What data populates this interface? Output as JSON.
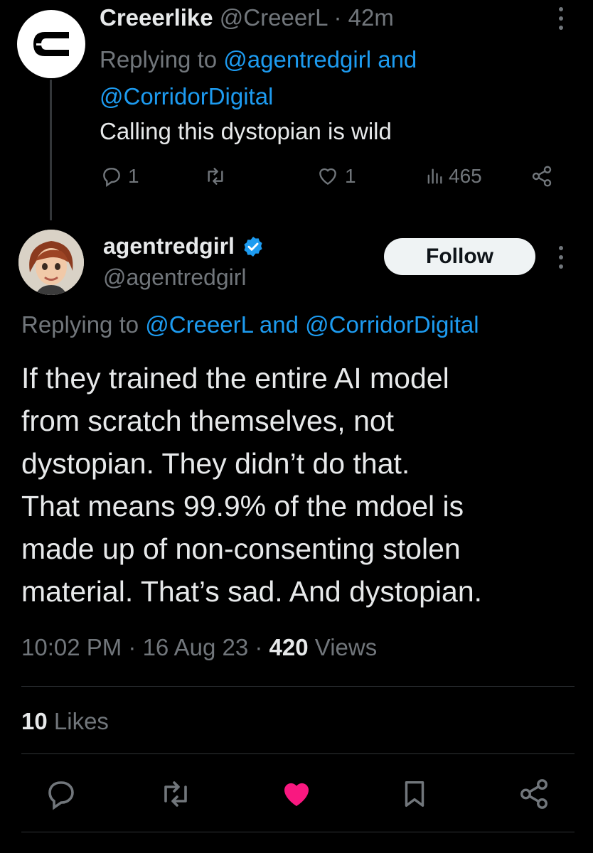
{
  "reply_tweet": {
    "display_name": "Creeerlike",
    "handle_time": "@CreeerL · 42m",
    "replying_prefix": "Replying to ",
    "replying_mentions": "@agentredgirl and @CorridorDigital",
    "text": "Calling this dystopian  is wild",
    "reply_count": "1",
    "like_count": "1",
    "view_count": "465",
    "icons": [
      "logo-icon",
      "more-icon",
      "reply-icon",
      "retweet-icon",
      "like-icon",
      "views-icon",
      "share-icon"
    ]
  },
  "main_tweet": {
    "display_name": "agentredgirl",
    "handle": "@agentredgirl",
    "follow_label": "Follow",
    "replying_prefix": "Replying to ",
    "replying_mention_1": "@CreeerL",
    "replying_and": " and ",
    "replying_mention_2": "@CorridorDigital",
    "text_lines": [
      "If they trained the entire AI model",
      "from scratch themselves, not",
      "dystopian. They didn’t do that.",
      "That means 99.9% of the mdoel is",
      "made up of non-consenting stolen",
      "material. That’s sad. And dystopian."
    ],
    "time_date": "10:02 PM · 16 Aug 23 · ",
    "views_count": "420",
    "views_label": " Views",
    "likes_count": "10",
    "likes_label": " Likes",
    "icons": [
      "avatar",
      "verified-badge-icon",
      "more-icon",
      "reply-icon",
      "retweet-icon",
      "like-icon",
      "bookmark-icon",
      "share-icon"
    ]
  },
  "colors": {
    "background": "#000000",
    "text": "#e7e9ea",
    "muted": "#71767b",
    "link": "#1d9bf0",
    "like_active": "#f91880",
    "verified": "#1d9bf0"
  }
}
